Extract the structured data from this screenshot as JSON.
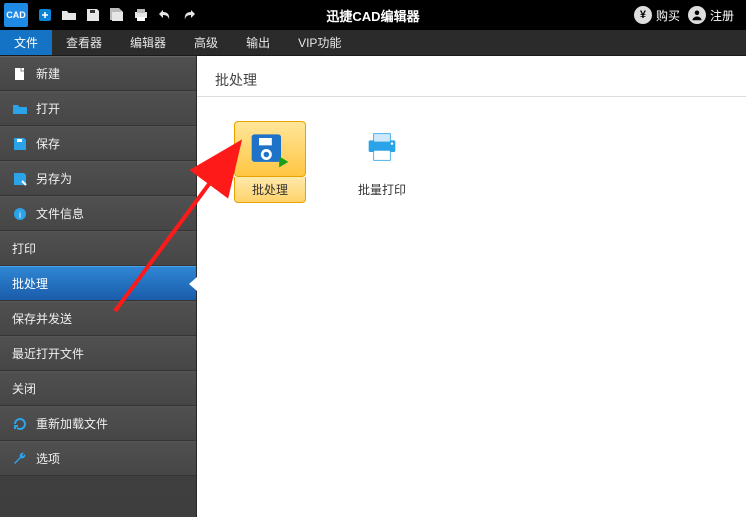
{
  "titlebar": {
    "app_title": "迅捷CAD编辑器",
    "buy_label": "购买",
    "register_label": "注册"
  },
  "menubar": {
    "tabs": [
      "文件",
      "查看器",
      "编辑器",
      "高级",
      "输出",
      "VIP功能"
    ],
    "active_index": 0
  },
  "sidebar": {
    "items": [
      {
        "label": "新建",
        "icon": "file-new"
      },
      {
        "label": "打开",
        "icon": "folder-open"
      },
      {
        "label": "保存",
        "icon": "save"
      },
      {
        "label": "另存为",
        "icon": "save-as"
      },
      {
        "label": "文件信息",
        "icon": "info"
      },
      {
        "label": "打印",
        "icon": "print"
      },
      {
        "label": "批处理",
        "icon": null,
        "selected": true
      },
      {
        "label": "保存并发送",
        "icon": null
      },
      {
        "label": "最近打开文件",
        "icon": null
      },
      {
        "label": "关闭",
        "icon": null
      },
      {
        "label": "重新加载文件",
        "icon": "reload"
      },
      {
        "label": "选项",
        "icon": "options"
      }
    ]
  },
  "content": {
    "heading": "批处理",
    "tiles": [
      {
        "label": "批处理",
        "icon": "batch-save",
        "highlight": true
      },
      {
        "label": "批量打印",
        "icon": "batch-print",
        "highlight": false
      }
    ]
  }
}
